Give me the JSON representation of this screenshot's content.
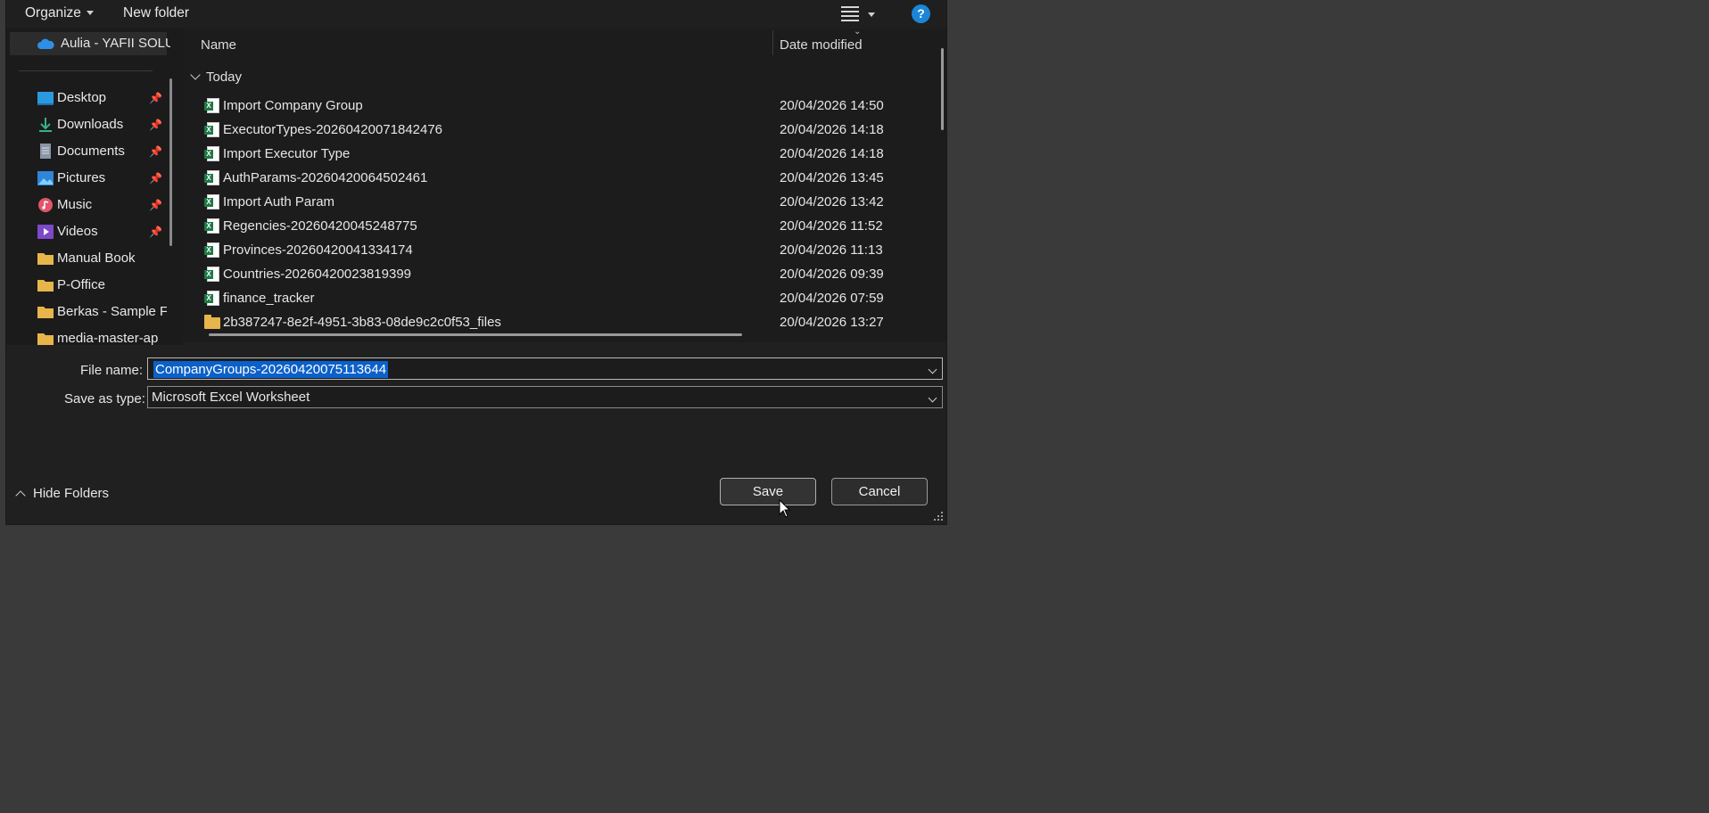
{
  "toolbar": {
    "organize_label": "Organize",
    "new_folder_label": "New folder",
    "help_label": "?"
  },
  "nav": {
    "top_item": "Aulia - YAFII SOLU",
    "items": [
      {
        "label": "Desktop",
        "icon": "desktop-icon",
        "pinned": true
      },
      {
        "label": "Downloads",
        "icon": "download-icon",
        "pinned": true
      },
      {
        "label": "Documents",
        "icon": "document-icon",
        "pinned": true
      },
      {
        "label": "Pictures",
        "icon": "pictures-icon",
        "pinned": true
      },
      {
        "label": "Music",
        "icon": "music-icon",
        "pinned": true
      },
      {
        "label": "Videos",
        "icon": "videos-icon",
        "pinned": true
      },
      {
        "label": "Manual Book",
        "icon": "folder-icon",
        "pinned": false
      },
      {
        "label": "P-Office",
        "icon": "folder-icon",
        "pinned": false
      },
      {
        "label": "Berkas - Sample F",
        "icon": "folder-icon",
        "pinned": false
      },
      {
        "label": "media-master-ap",
        "icon": "folder-icon",
        "pinned": false
      }
    ]
  },
  "files": {
    "columns": {
      "name": "Name",
      "date": "Date modified"
    },
    "group": "Today",
    "rows": [
      {
        "name": "Import Company Group",
        "date": "20/04/2026 14:50",
        "type": "xlsx"
      },
      {
        "name": "ExecutorTypes-20260420071842476",
        "date": "20/04/2026 14:18",
        "type": "xlsx"
      },
      {
        "name": "Import Executor Type",
        "date": "20/04/2026 14:18",
        "type": "xlsx"
      },
      {
        "name": "AuthParams-20260420064502461",
        "date": "20/04/2026 13:45",
        "type": "xlsx"
      },
      {
        "name": "Import Auth Param",
        "date": "20/04/2026 13:42",
        "type": "xlsx"
      },
      {
        "name": "Regencies-20260420045248775",
        "date": "20/04/2026 11:52",
        "type": "xlsx"
      },
      {
        "name": "Provinces-20260420041334174",
        "date": "20/04/2026 11:13",
        "type": "xlsx"
      },
      {
        "name": "Countries-20260420023819399",
        "date": "20/04/2026 09:39",
        "type": "xlsx"
      },
      {
        "name": "finance_tracker",
        "date": "20/04/2026 07:59",
        "type": "xlsx"
      },
      {
        "name": "2b387247-8e2f-4951-3b83-08de9c2c0f53_files",
        "date": "20/04/2026 13:27",
        "type": "folder"
      }
    ]
  },
  "form": {
    "file_name_label": "File name:",
    "file_name_value": "CompanyGroups-20260420075113644",
    "save_type_label": "Save as type:",
    "save_type_value": "Microsoft Excel Worksheet",
    "hide_folders_label": "Hide Folders",
    "save_label": "Save",
    "cancel_label": "Cancel"
  },
  "colors": {
    "accent": "#0b60c9",
    "help": "#1a86d8",
    "excel": "#1d7a45",
    "folder": "#e8b54b"
  }
}
